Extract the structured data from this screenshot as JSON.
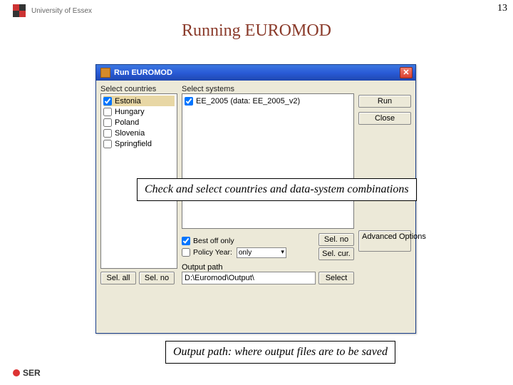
{
  "page_number": "13",
  "slide_title": "Running EUROMOD",
  "uoe_label": "University of Essex",
  "iser_label": "SER",
  "window": {
    "title": "Run EUROMOD",
    "close_glyph": "✕",
    "left": {
      "label": "Select countries",
      "items": [
        {
          "label": "Estonia",
          "checked": true,
          "selected": true
        },
        {
          "label": "Hungary",
          "checked": false,
          "selected": false
        },
        {
          "label": "Poland",
          "checked": false,
          "selected": false
        },
        {
          "label": "Slovenia",
          "checked": false,
          "selected": false
        },
        {
          "label": "Springfield",
          "checked": false,
          "selected": false
        }
      ],
      "select_all": "Sel. all",
      "select_none": "Sel. no"
    },
    "mid": {
      "label": "Select systems",
      "items": [
        {
          "label": "EE_2005 (data: EE_2005_v2)",
          "checked": true
        }
      ],
      "best_off": {
        "label": "Best off only",
        "checked": true
      },
      "policy_year": {
        "label": "Policy Year:",
        "dropdown": "only",
        "checked": false
      },
      "select_none": "Sel. no",
      "select_current": "Sel. cur."
    },
    "right": {
      "run": "Run",
      "close": "Close",
      "advanced": "Advanced Options"
    },
    "output": {
      "label": "Output path",
      "value": "D:\\Euromod\\Output\\",
      "select": "Select"
    }
  },
  "callouts": {
    "c1": "Check and select countries and data-system combinations",
    "c2": "Output path: where output files are to be saved"
  }
}
